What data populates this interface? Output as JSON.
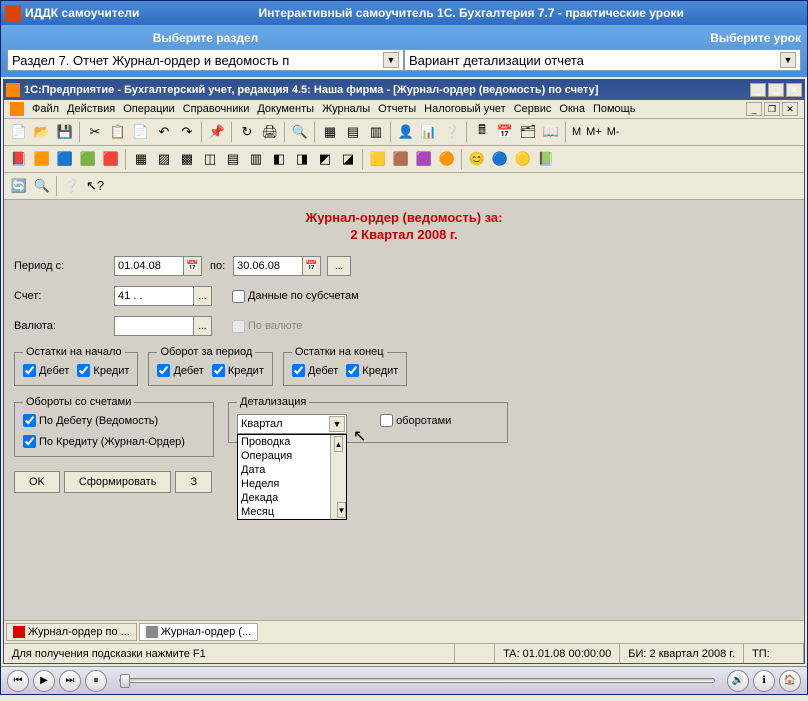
{
  "outer": {
    "appName": "ИДДК самоучители",
    "subtitle": "Интерактивный самоучитель 1C. Бухгалтерия 7.7 - практические уроки"
  },
  "selector": {
    "leftLabel": "Выберите раздел",
    "rightLabel": "Выберите урок",
    "section": "Раздел 7. Отчет Журнал-ордер и ведомость п",
    "lesson": "Вариант детализации отчета"
  },
  "inner": {
    "title": "1С:Предприятие - Бухгалтерский учет, редакция 4.5: Наша фирма - [Журнал-ордер (ведомость) по счету]"
  },
  "menu": {
    "items": [
      "Файл",
      "Действия",
      "Операции",
      "Справочники",
      "Документы",
      "Журналы",
      "Отчеты",
      "Налоговый учет",
      "Сервис",
      "Окна",
      "Помощь"
    ]
  },
  "form": {
    "header": "Журнал-ордер (ведомость) за:",
    "subheader": "2 Квартал 2008 г.",
    "periodFromLabel": "Период с:",
    "periodFrom": "01.04.08",
    "periodToLabel": "по:",
    "periodTo": "30.06.08",
    "accountLabel": "Счет:",
    "account": "41 . .",
    "subAccounts": "Данные по субсчетам",
    "currencyLabel": "Валюта:",
    "currency": "",
    "byCurrency": "По валюте",
    "groups": {
      "startBal": {
        "legend": "Остатки на начало",
        "debit": "Дебет",
        "credit": "Кредит"
      },
      "turnover": {
        "legend": "Оборот за период",
        "debit": "Дебет",
        "credit": "Кредит"
      },
      "endBal": {
        "legend": "Остатки на конец",
        "debit": "Дебет",
        "credit": "Кредит"
      },
      "accTurnover": {
        "legend": "Обороты со счетами",
        "byDebit": "По Дебету (Ведомость)",
        "byCredit": "По Кредиту (Журнал-Ордер)"
      },
      "detail": {
        "legend": "Детализация",
        "selected": "Квартал",
        "options": [
          "Проводка",
          "Операция",
          "Дата",
          "Неделя",
          "Декада",
          "Месяц"
        ],
        "graphLabel": "оборотами"
      }
    },
    "buttons": {
      "ok": "OK",
      "form": "Сформировать",
      "close": "З"
    }
  },
  "tabs": {
    "first": "Журнал-ордер по ...",
    "second": "Журнал-ордер (..."
  },
  "status": {
    "hint": "Для получения подсказки нажмите F1",
    "ta": "TA: 01.01.08 00:00:00",
    "bi": "БИ: 2 квартал 2008 г.",
    "tp": "ТП:"
  },
  "tbText": {
    "m": "M",
    "mp": "M+",
    "mm": "M-"
  }
}
